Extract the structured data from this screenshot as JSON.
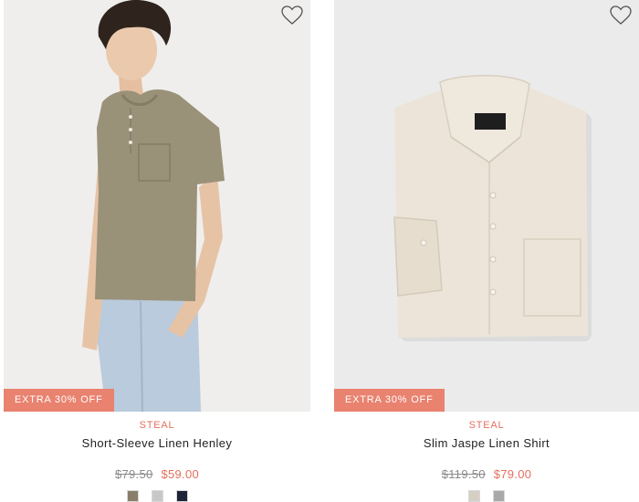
{
  "products": [
    {
      "promo": "EXTRA 30% OFF",
      "tag": "STEAL",
      "name": "Short-Sleeve Linen Henley",
      "old_price": "$79.50",
      "new_price": "$59.00",
      "swatches": [
        "#8a7e6a",
        "#c8c8c8",
        "#1e2438"
      ],
      "image": "model-in-olive-linen-henley"
    },
    {
      "promo": "EXTRA 30% OFF",
      "tag": "STEAL",
      "name": "Slim Jaspe Linen Shirt",
      "old_price": "$119.50",
      "new_price": "$79.00",
      "swatches": [
        "#d6cfc6",
        "#a9a9a9"
      ],
      "image": "folded-beige-linen-shirt"
    }
  ],
  "colors": {
    "accent": "#e46f5d",
    "badge": "#e9826f"
  }
}
